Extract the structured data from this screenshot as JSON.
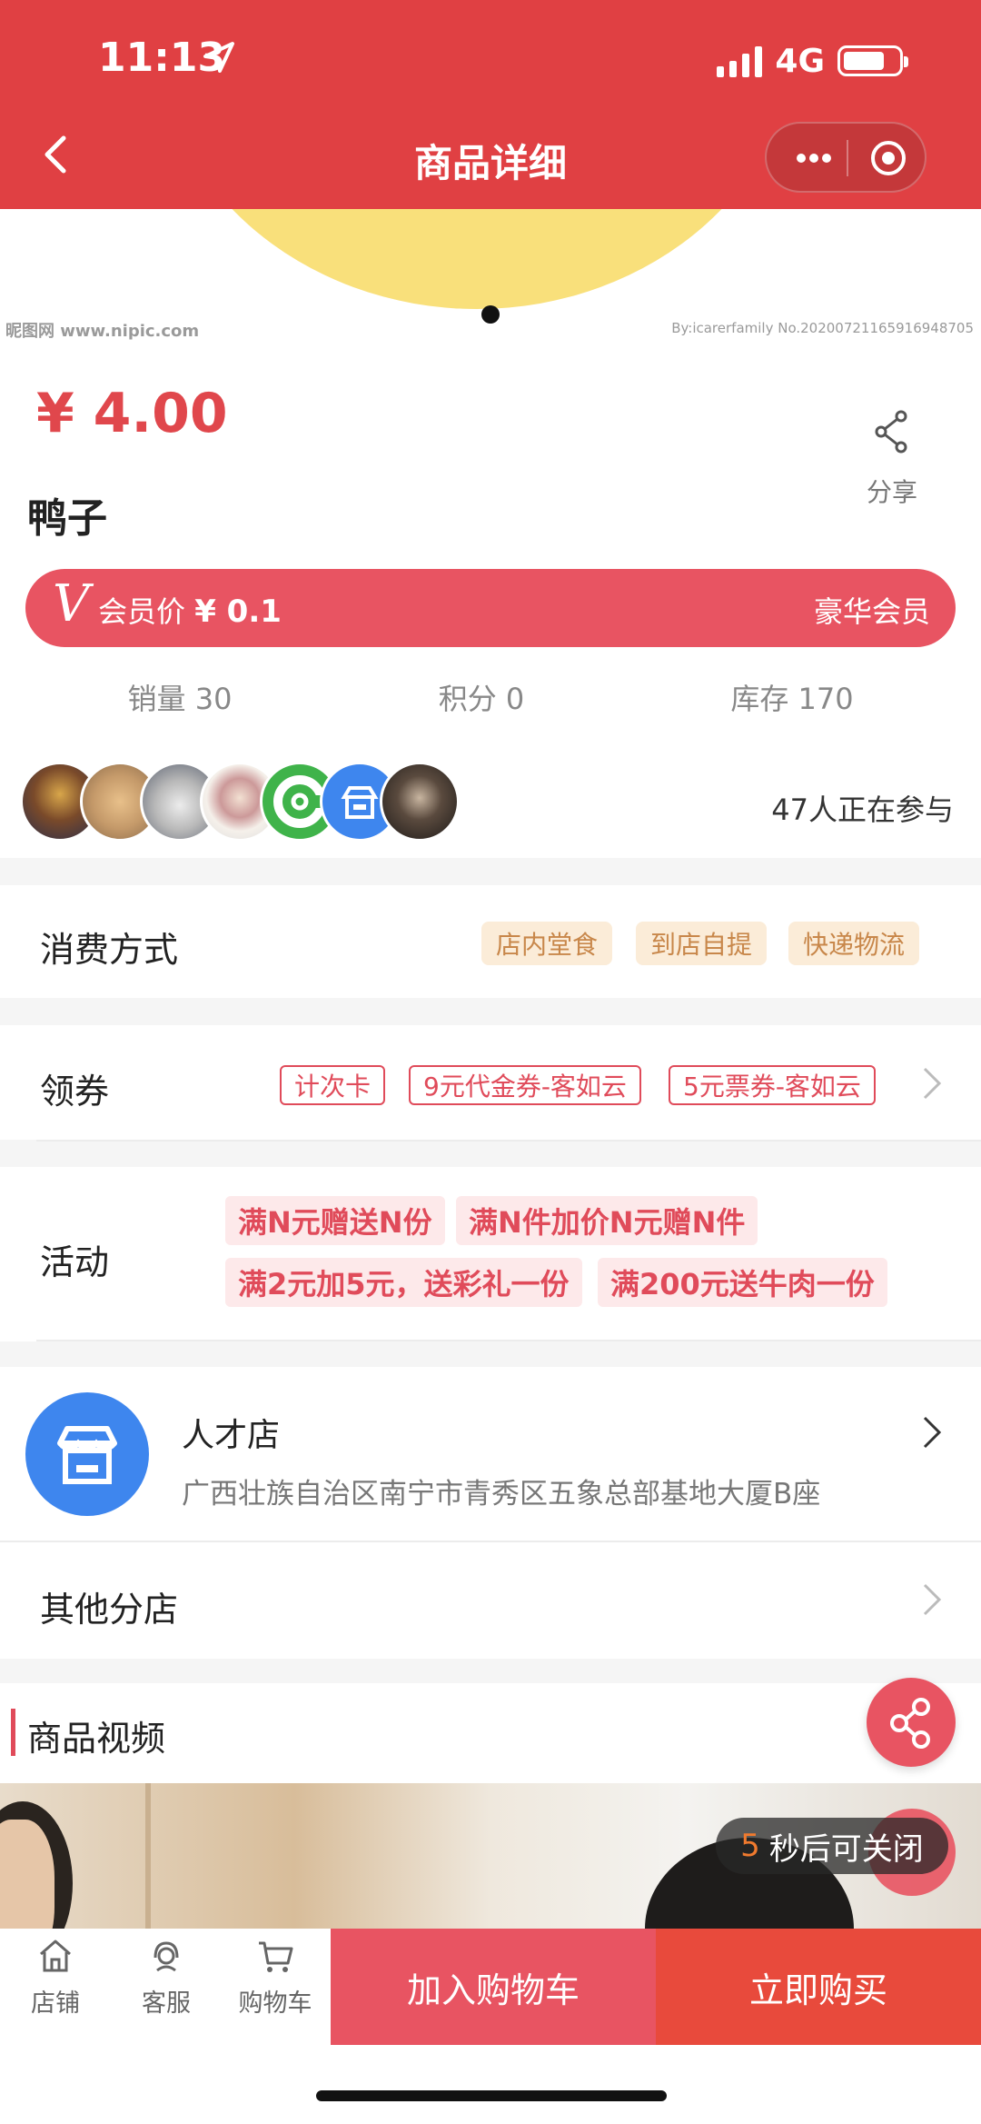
{
  "status": {
    "time": "11:13",
    "network": "4G"
  },
  "nav": {
    "title": "商品详细"
  },
  "hero": {
    "watermark_left": "昵图网 www.nipic.com",
    "watermark_right": "By:icarerfamily No.20200721165916948705"
  },
  "product": {
    "price": "¥ 4.00",
    "name": "鸭子",
    "share_label": "分享",
    "member_v": "V",
    "member_label": "会员价",
    "member_price": "¥ 0.1",
    "member_level": "豪华会员",
    "stats": {
      "sales": "销量 30",
      "points": "积分 0",
      "stock": "库存 170"
    },
    "participants": "47人正在参与"
  },
  "consume": {
    "label": "消费方式",
    "tags": [
      "店内堂食",
      "到店自提",
      "快递物流"
    ]
  },
  "coupons": {
    "label": "领券",
    "tags": [
      "计次卡",
      "9元代金券-客如云",
      "5元票券-客如云"
    ]
  },
  "activity": {
    "label": "活动",
    "tags": [
      "满N元赠送N份",
      "满N件加价N元赠N件",
      "满2元加5元，送彩礼一份",
      "满200元送牛肉一份"
    ]
  },
  "store": {
    "name": "人才店",
    "address": "广西壮族自治区南宁市青秀区五象总部基地大厦B座"
  },
  "branches": {
    "label": "其他分店"
  },
  "video": {
    "title": "商品视频",
    "close_seconds": "5",
    "close_text": "秒后可关闭"
  },
  "bottom": {
    "tabs": [
      {
        "label": "店铺",
        "icon": "shop-icon"
      },
      {
        "label": "客服",
        "icon": "customer-service-icon"
      },
      {
        "label": "购物车",
        "icon": "cart-icon"
      }
    ],
    "add_cart": "加入购物车",
    "buy_now": "立即购买"
  },
  "colors": {
    "brand_red": "#e04043",
    "accent_pink": "#e85462",
    "price_red": "#e0474c",
    "buy_red": "#e84a3c"
  }
}
